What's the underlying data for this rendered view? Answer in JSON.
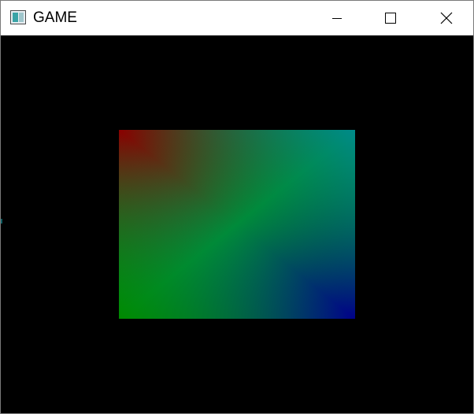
{
  "window": {
    "title": "GAME"
  },
  "titlebar": {
    "icon": "app-window-icon",
    "controls": [
      "minimize-icon",
      "maximize-icon",
      "close-icon"
    ]
  },
  "canvas": {
    "background": "#000000",
    "quad_colors": {
      "top_left": "#8a0000",
      "top_right": "#008a8a",
      "bottom_left": "#008a00",
      "bottom_right": "#00008a",
      "diagonal": "#008a3a"
    }
  }
}
